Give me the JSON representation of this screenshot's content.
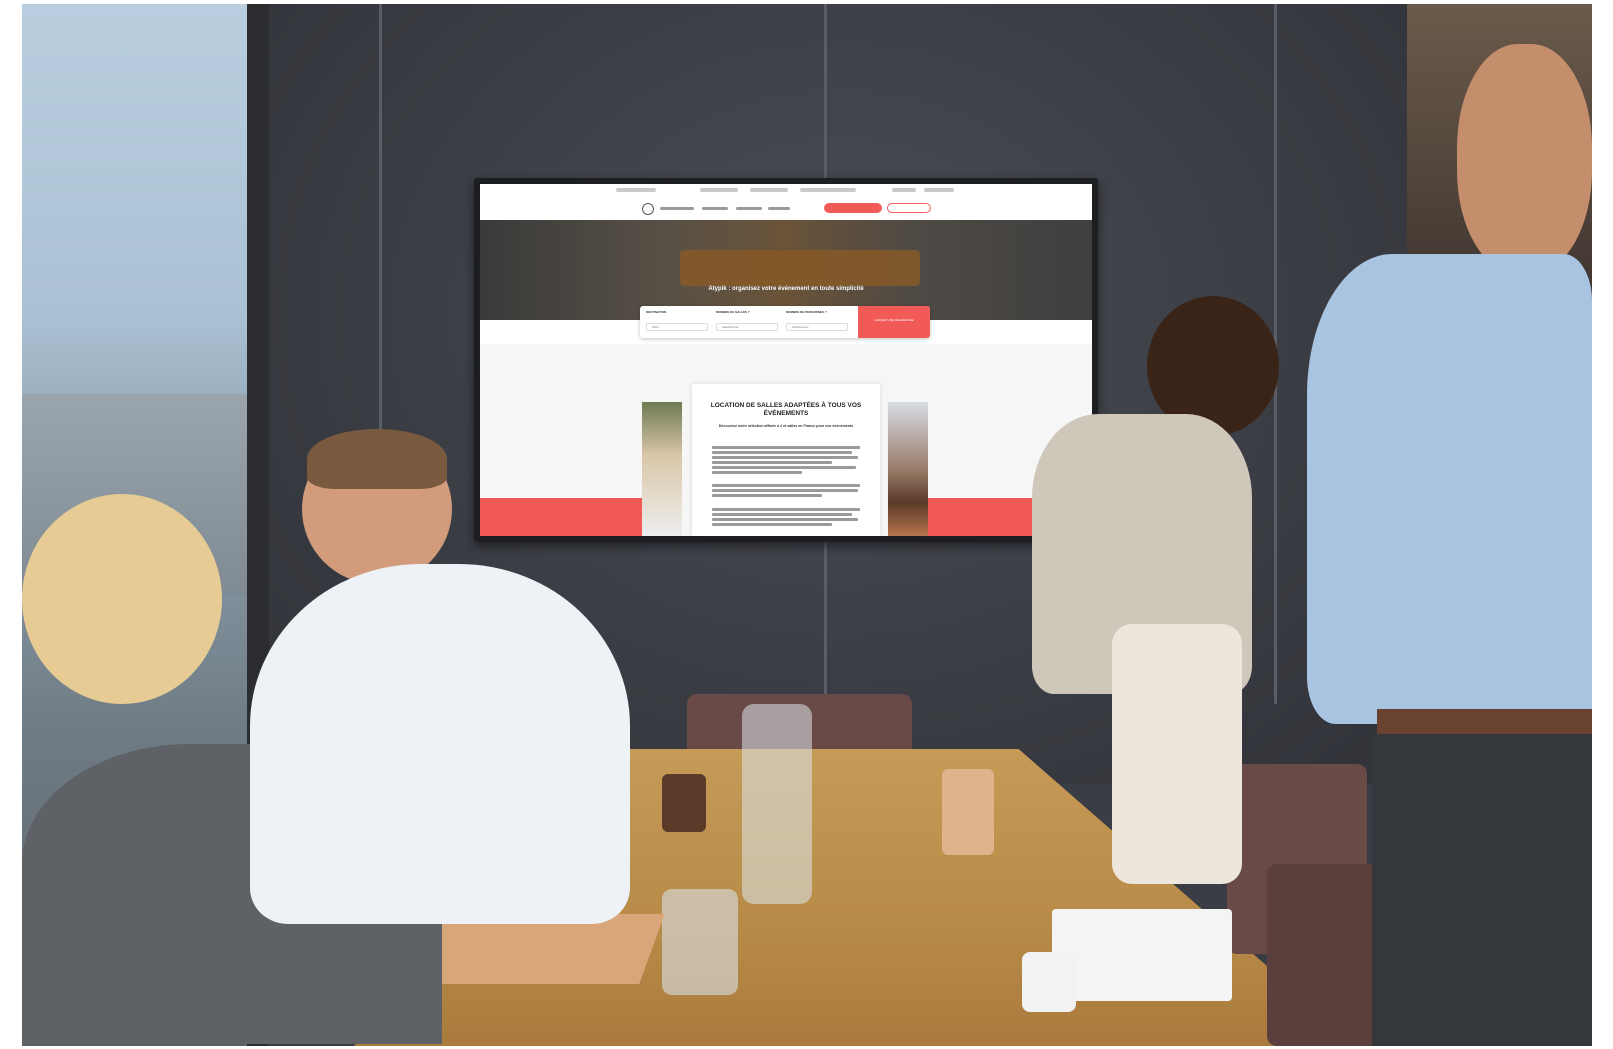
{
  "photo": {
    "screen": {
      "hero_title": "Atypik : organisez votre événement en toute simplicité",
      "search_fields": [
        {
          "label": "DESTINATION",
          "value": "Paris"
        },
        {
          "label": "NOMBRE DE SALLES ?",
          "value": "Sélectionner"
        },
        {
          "label": "NOMBRE DE PERSONNES ?",
          "value": "Sélectionner"
        }
      ],
      "search_button": "LANCER UNE RECHERCHE",
      "card_title": "LOCATION DE SALLES ADAPTÉES À TOUS VOS ÉVÉNEMENTS",
      "card_subtitle": "Découvrez notre sélection affinée à 4 et salles en France pour vos événements"
    },
    "colors": {
      "accent": "#f15a57",
      "wall": "#3b3d44",
      "table": "#c69a57"
    }
  }
}
